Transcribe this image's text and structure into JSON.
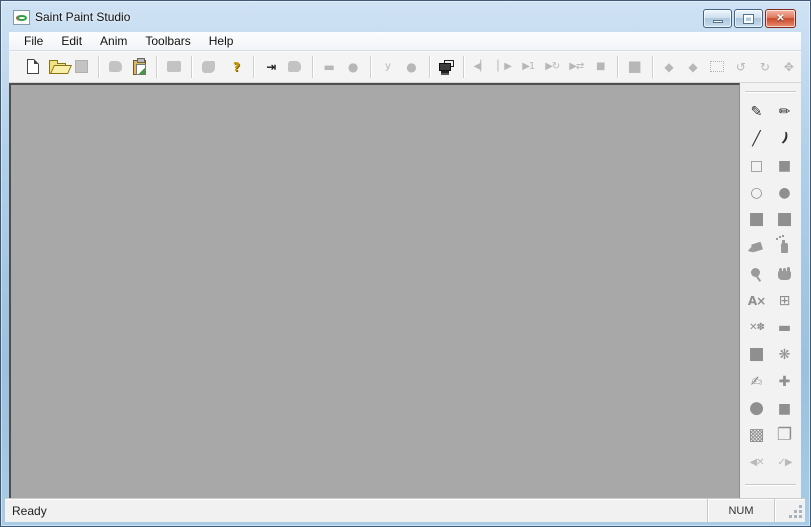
{
  "window": {
    "title": "Saint Paint Studio",
    "controls": {
      "minimize": "minimize",
      "maximize": "maximize",
      "close_glyph": "✕"
    }
  },
  "colors": {
    "titlebar_blue": "#a9cce6",
    "canvas_gray": "#a8a8a8",
    "toolbar_bg": "#f4f4f4",
    "close_red": "#c84a2d",
    "help_yellow": "#c79a00"
  },
  "menu": {
    "items": [
      {
        "name": "menu-file",
        "label": "File"
      },
      {
        "name": "menu-edit",
        "label": "Edit"
      },
      {
        "name": "menu-anim",
        "label": "Anim"
      },
      {
        "name": "menu-toolbars",
        "label": "Toolbars"
      },
      {
        "name": "menu-help",
        "label": "Help"
      }
    ]
  },
  "toolbar": {
    "buttons": [
      {
        "name": "new-button",
        "icon": "new-document-icon",
        "cls": "ic-new",
        "enabled": true
      },
      {
        "name": "open-button",
        "icon": "open-folder-icon",
        "cls": "ic-open",
        "enabled": true
      },
      {
        "name": "save-button",
        "icon": "save-icon",
        "cls": "ic-save",
        "enabled": false
      },
      {
        "sep": true
      },
      {
        "name": "undo-button",
        "icon": "undo-icon",
        "cls": "ic-blob",
        "enabled": false
      },
      {
        "name": "paste-button",
        "icon": "paste-clipboard-icon",
        "cls": "ic-paste",
        "enabled": true
      },
      {
        "sep": true
      },
      {
        "name": "print-button",
        "icon": "print-icon",
        "cls": "ic-blob2",
        "enabled": false
      },
      {
        "sep": true
      },
      {
        "name": "acquire-button",
        "icon": "acquire-icon",
        "cls": "ic-blob3",
        "enabled": false
      },
      {
        "gap": true
      },
      {
        "name": "help-button",
        "icon": "help-question-icon",
        "glyph": "?",
        "gcls": "g-help",
        "enabled": true
      },
      {
        "sep": true
      },
      {
        "name": "fit-frame-button",
        "icon": "fit-to-frame-icon",
        "glyph": "⇥",
        "gcls": "g-dark",
        "enabled": true
      },
      {
        "name": "frame-options-button",
        "icon": "frame-options-icon",
        "cls": "ic-blob",
        "enabled": false
      },
      {
        "sep": true
      },
      {
        "name": "select-rectangle-button",
        "icon": "rectangle-icon",
        "glyph": "▬",
        "enabled": false
      },
      {
        "name": "select-ellipse-button",
        "icon": "ellipse-icon",
        "glyph": "●",
        "enabled": false
      },
      {
        "sep": true
      },
      {
        "name": "brush-mode-button",
        "icon": "brush-icon",
        "glyph": "y",
        "gcls": "g-small",
        "enabled": false
      },
      {
        "name": "dot-mode-button",
        "icon": "dot-icon",
        "glyph": "●",
        "enabled": false
      },
      {
        "sep": true
      },
      {
        "name": "animation-frames-button",
        "icon": "film-frames-icon",
        "cls": "ic-projector",
        "enabled": true
      },
      {
        "sep": true
      },
      {
        "name": "previous-frame-button",
        "icon": "previous-frame-icon",
        "glyph": "◀▏",
        "gcls": "g-small",
        "enabled": false
      },
      {
        "name": "next-frame-button",
        "icon": "next-frame-icon",
        "glyph": "▏▶",
        "gcls": "g-small",
        "enabled": false
      },
      {
        "name": "play-once-button",
        "icon": "play-once-icon",
        "glyph": "▶1",
        "gcls": "g-small",
        "enabled": false
      },
      {
        "name": "play-loop-button",
        "icon": "play-loop-icon",
        "glyph": "▶↻",
        "gcls": "g-small",
        "enabled": false
      },
      {
        "name": "play-pingpong-button",
        "icon": "play-pingpong-icon",
        "glyph": "▶⇄",
        "gcls": "g-small",
        "enabled": false
      },
      {
        "name": "stop-button",
        "icon": "stop-icon",
        "glyph": "■",
        "gcls": "g-small",
        "enabled": false
      },
      {
        "sep": true
      },
      {
        "name": "halt-button",
        "icon": "stop-square-icon",
        "glyph": "■",
        "gcls": "g-big",
        "enabled": false
      },
      {
        "sep": true
      },
      {
        "name": "flip-horizontal-button",
        "icon": "flip-horizontal-icon",
        "glyph": "◆",
        "enabled": false
      },
      {
        "name": "flip-vertical-button",
        "icon": "flip-vertical-icon",
        "glyph": "◆",
        "enabled": false
      },
      {
        "name": "crop-button",
        "icon": "crop-icon",
        "cls": "ic-crop",
        "enabled": false
      },
      {
        "name": "rotate-left-button",
        "icon": "rotate-left-icon",
        "glyph": "↺",
        "enabled": false
      },
      {
        "name": "rotate-right-button",
        "icon": "rotate-right-icon",
        "glyph": "↻",
        "enabled": false
      },
      {
        "name": "resize-button",
        "icon": "resize-icon",
        "glyph": "✥",
        "enabled": false
      }
    ]
  },
  "palette": {
    "tools": [
      {
        "name": "pen-tool",
        "icon": "pen-icon",
        "glyph": "✎",
        "gcls": "dark",
        "enabled": true
      },
      {
        "name": "marker-tool",
        "icon": "marker-icon",
        "glyph": "✏",
        "gcls": "dark",
        "enabled": true
      },
      {
        "name": "line-tool",
        "icon": "line-icon",
        "glyph": "╱",
        "gcls": "dark",
        "enabled": true
      },
      {
        "name": "curve-tool",
        "icon": "curve-icon",
        "glyph": ")",
        "gcls": "dark curve",
        "enabled": true
      },
      {
        "name": "rectangle-outline-tool",
        "icon": "rectangle-outline-icon",
        "glyph": "□",
        "enabled": true
      },
      {
        "name": "rectangle-filled-tool",
        "icon": "rectangle-filled-icon",
        "glyph": "■",
        "enabled": true
      },
      {
        "name": "ellipse-outline-tool",
        "icon": "ellipse-outline-icon",
        "glyph": "○",
        "enabled": true
      },
      {
        "name": "ellipse-filled-tool",
        "icon": "ellipse-filled-icon",
        "glyph": "●",
        "enabled": true
      },
      {
        "name": "roundrect-tool",
        "icon": "filled-square-icon",
        "glyph": "■",
        "gcls": "big",
        "enabled": true
      },
      {
        "name": "polygon-fill-tool",
        "icon": "filled-square-icon",
        "glyph": "■",
        "gcls": "big",
        "enabled": true
      },
      {
        "name": "flood-fill-tool",
        "icon": "paint-bucket-icon",
        "cls": "ic-bucket",
        "enabled": true
      },
      {
        "name": "airbrush-tool",
        "icon": "spray-can-icon",
        "cls": "ic-spray",
        "enabled": true
      },
      {
        "name": "color-picker-tool",
        "icon": "picker-icon",
        "cls": "ic-picker",
        "enabled": true
      },
      {
        "name": "pan-tool",
        "icon": "hand-icon",
        "cls": "ic-hand",
        "enabled": true
      },
      {
        "name": "text-tool",
        "icon": "text-icon",
        "glyph": "A×",
        "gcls": "textg",
        "enabled": true
      },
      {
        "name": "paste-image-tool",
        "icon": "paste-dialog-icon",
        "glyph": "⊞",
        "enabled": true
      },
      {
        "name": "eraser-tool",
        "icon": "erase-icon",
        "glyph": "✕✽",
        "gcls": "small",
        "enabled": true
      },
      {
        "name": "gradient-tool",
        "icon": "gradient-rect-icon",
        "glyph": "▬",
        "enabled": true
      },
      {
        "name": "rounded-select-tool",
        "icon": "rounded-square-icon",
        "glyph": "■",
        "gcls": "big",
        "enabled": true
      },
      {
        "name": "effects-tool",
        "icon": "flower-pattern-icon",
        "glyph": "❋",
        "enabled": true
      },
      {
        "name": "freehand-tool",
        "icon": "writing-hand-icon",
        "glyph": "✍",
        "enabled": true
      },
      {
        "name": "move-tool",
        "icon": "plus-pad-icon",
        "glyph": "✚",
        "enabled": true
      },
      {
        "name": "blob-select-tool",
        "icon": "blob-icon",
        "glyph": "●",
        "gcls": "big",
        "enabled": true
      },
      {
        "name": "square-select-tool",
        "icon": "square-icon",
        "glyph": "■",
        "enabled": true
      },
      {
        "name": "dither-tool",
        "icon": "textured-square-icon",
        "glyph": "▩",
        "gcls": "big",
        "enabled": true
      },
      {
        "name": "layers-tool",
        "icon": "layered-squares-icon",
        "glyph": "❐",
        "gcls": "big",
        "enabled": true
      },
      {
        "name": "cancel-edit-button",
        "icon": "cancel-arrow-icon",
        "glyph": "◀✕",
        "gcls": "light small",
        "enabled": false
      },
      {
        "name": "apply-edit-button",
        "icon": "apply-arrow-icon",
        "glyph": "✓▶",
        "gcls": "light small",
        "enabled": false
      }
    ]
  },
  "status": {
    "message": "Ready",
    "indicator": "NUM"
  }
}
